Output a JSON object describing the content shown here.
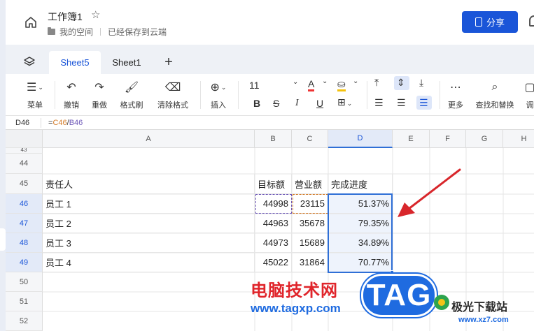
{
  "app": {
    "title": "工作簿1",
    "location": "我的空间",
    "save_status": "已经保存到云端",
    "share_label": "分享",
    "accent": "#1a55d8"
  },
  "tabs": [
    {
      "label": "Sheet5",
      "active": true
    },
    {
      "label": "Sheet1",
      "active": false
    }
  ],
  "toolbar": {
    "menu": "菜单",
    "undo": "撤销",
    "redo": "重做",
    "format_painter": "格式刷",
    "clear_format": "清除格式",
    "insert": "插入",
    "font_size": "11",
    "more": "更多",
    "find_replace": "查找和替换",
    "cut_off": "调",
    "font_color_letter": "A",
    "bold": "B",
    "strike": "S",
    "italic": "I",
    "underline": "U"
  },
  "formula_bar": {
    "cell_ref": "D46",
    "eq": "=",
    "ref1": "C46",
    "op": "/",
    "ref2": "B46"
  },
  "grid": {
    "columns": [
      "A",
      "B",
      "C",
      "D",
      "E",
      "F",
      "G",
      "H"
    ],
    "top_partial_row": "43",
    "rows": [
      {
        "n": "44",
        "a": "",
        "b": "",
        "c": "",
        "d": ""
      },
      {
        "n": "45",
        "a": "责任人",
        "b": "目标额",
        "c": "营业额",
        "d": "完成进度"
      },
      {
        "n": "46",
        "a": "员工 1",
        "b": "44998",
        "c": "23115",
        "d": "51.37%"
      },
      {
        "n": "47",
        "a": "员工 2",
        "b": "44963",
        "c": "35678",
        "d": "79.35%"
      },
      {
        "n": "48",
        "a": "员工 3",
        "b": "44973",
        "c": "15689",
        "d": "34.89%"
      },
      {
        "n": "49",
        "a": "员工 4",
        "b": "45022",
        "c": "31864",
        "d": "70.77%"
      },
      {
        "n": "50",
        "a": "",
        "b": "",
        "c": "",
        "d": ""
      },
      {
        "n": "51",
        "a": "",
        "b": "",
        "c": "",
        "d": ""
      },
      {
        "n": "52",
        "a": "",
        "b": "",
        "c": "",
        "d": ""
      }
    ]
  },
  "watermark": {
    "cn": "电脑技术网",
    "url": "www.tagxp.com",
    "tag": "TAG",
    "site": "极光下载站",
    "site_url": "www.xz7.com"
  }
}
